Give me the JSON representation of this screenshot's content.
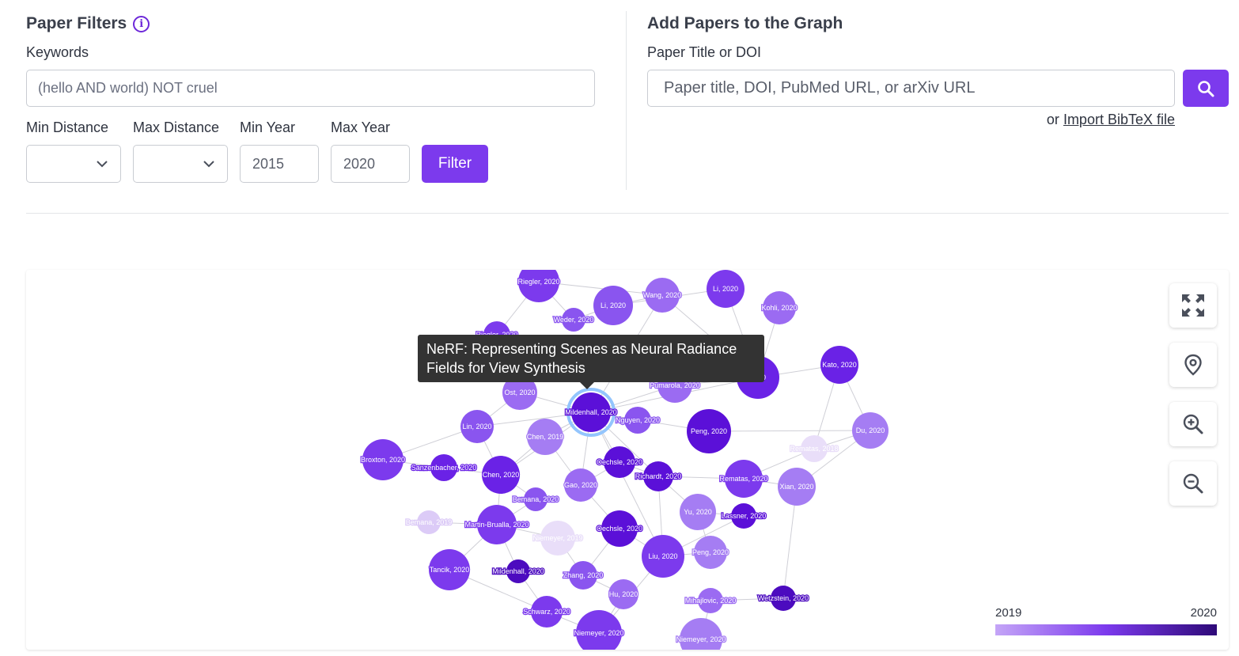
{
  "filters": {
    "title": "Paper Filters",
    "info_icon": "info-icon",
    "keywords_label": "Keywords",
    "keywords_placeholder": "(hello AND world) NOT cruel",
    "min_distance_label": "Min Distance",
    "max_distance_label": "Max Distance",
    "min_year_label": "Min Year",
    "max_year_label": "Max Year",
    "min_year_value": "2015",
    "max_year_value": "2020",
    "filter_button": "Filter"
  },
  "add_papers": {
    "title": "Add Papers to the Graph",
    "input_label": "Paper Title or DOI",
    "placeholder": "Paper title, DOI, PubMed URL, or arXiv URL",
    "search_icon": "search-icon",
    "import_prefix": "or",
    "import_link": "Import BibTeX file"
  },
  "graph": {
    "tooltip": "NeRF: Representing Scenes as Neural Radiance Fields for View Synthesis",
    "controls": [
      "fullscreen-icon",
      "locate-icon",
      "zoom-in-icon",
      "zoom-out-icon"
    ],
    "legend": {
      "min": "2019",
      "max": "2020",
      "colors": [
        "#c4a5f7",
        "#7c3aed",
        "#2e0a78"
      ]
    },
    "nodes": [
      {
        "label": "Riegler, 2020",
        "color": "#7c3aed"
      },
      {
        "label": "Li, 2020",
        "color": "#7c3aed"
      },
      {
        "label": "Wang, 2020",
        "color": "#9b6bf2"
      },
      {
        "label": "Li, 2020",
        "color": "#8a55ef"
      },
      {
        "label": "Kohli, 2020",
        "color": "#9b6bf2"
      },
      {
        "label": "Weder, 2020",
        "color": "#8a55ef"
      },
      {
        "label": "Riegler, 2020",
        "color": "#7c3aed"
      },
      {
        "label": "Kato, 2020",
        "color": "#6a22e6"
      },
      {
        "label": "Ost, 2020",
        "color": "#9b6bf2"
      },
      {
        "label": "Pumarola, 2020",
        "color": "#9b6bf2"
      },
      {
        "label": "2020",
        "color": "#6a22e6"
      },
      {
        "label": "Mildenhall, 2020",
        "color": "#5b10d8"
      },
      {
        "label": "Nguyen, 2020",
        "color": "#8a55ef"
      },
      {
        "label": "Lin, 2020",
        "color": "#8a55ef"
      },
      {
        "label": "Chen, 2019",
        "color": "#a57df3"
      },
      {
        "label": "Peng, 2020",
        "color": "#5b10d8"
      },
      {
        "label": "Du, 2020",
        "color": "#a57df3"
      },
      {
        "label": "Broxton, 2020",
        "color": "#7c3aed"
      },
      {
        "label": "Sanzenbacher, 2020",
        "color": "#6a22e6"
      },
      {
        "label": "Chen, 2020",
        "color": "#6a22e6"
      },
      {
        "label": "Oechsle, 2020",
        "color": "#5b10d8"
      },
      {
        "label": "Rematas, 2018",
        "color": "#e9def9"
      },
      {
        "label": "Richardt, 2020",
        "color": "#5b10d8"
      },
      {
        "label": "Gao, 2020",
        "color": "#9b6bf2"
      },
      {
        "label": "Rematas, 2020",
        "color": "#7c3aed"
      },
      {
        "label": "Xian, 2020",
        "color": "#a57df3"
      },
      {
        "label": "Bemana, 2020",
        "color": "#8a55ef"
      },
      {
        "label": "Yu, 2020",
        "color": "#a57df3"
      },
      {
        "label": "Lassner, 2020",
        "color": "#5b10d8"
      },
      {
        "label": "Bemana, 2019",
        "color": "#dccbf7"
      },
      {
        "label": "Martin-Brualla, 2020",
        "color": "#7c3aed"
      },
      {
        "label": "Niemeyer, 2019",
        "color": "#e9def9"
      },
      {
        "label": "Oechsle, 2020",
        "color": "#5b10d8"
      },
      {
        "label": "Liu, 2020",
        "color": "#7c3aed"
      },
      {
        "label": "Peng, 2020",
        "color": "#a57df3"
      },
      {
        "label": "Tancik, 2020",
        "color": "#7c3aed"
      },
      {
        "label": "Mildenhall, 2020",
        "color": "#4c0bbf"
      },
      {
        "label": "Zhang, 2020",
        "color": "#8a55ef"
      },
      {
        "label": "Hu, 2020",
        "color": "#9b6bf2"
      },
      {
        "label": "Mihajlovic, 2020",
        "color": "#9b6bf2"
      },
      {
        "label": "Wetzstein, 2020",
        "color": "#4c0bbf"
      },
      {
        "label": "Schwarz, 2020",
        "color": "#7c3aed"
      },
      {
        "label": "Niemeyer, 2020",
        "color": "#7c3aed"
      },
      {
        "label": "Niemeyer, 2020",
        "color": "#a57df3"
      }
    ]
  }
}
